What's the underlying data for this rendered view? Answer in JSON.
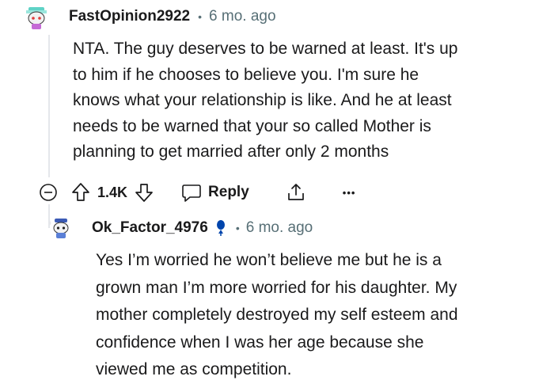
{
  "comment": {
    "username": "FastOpinion2922",
    "time_ago": "6 mo. ago",
    "separator": "•",
    "body_lines": [
      "NTA. The guy deserves to be warned at least. It's up",
      "to him if he chooses to believe you. I'm sure he",
      "knows what your relationship is like. And he at least",
      "needs to be warned that your so called Mother is",
      "planning to get married after only 2 months"
    ],
    "vote_count": "1.4K",
    "reply_label": "Reply",
    "more_label": "•••"
  },
  "reply": {
    "username": "Ok_Factor_4976",
    "time_ago": "6 mo. ago",
    "separator": "•",
    "body_lines": [
      "Yes I’m worried he won’t believe me but he is a",
      "grown man I’m more worried for his daughter. My",
      "mother completely destroyed my self esteem and",
      "confidence when I was her age because she",
      "viewed me as competition."
    ]
  },
  "icons": {
    "collapse": "collapse-icon",
    "upvote": "upvote-arrow-icon",
    "downvote": "downvote-arrow-icon",
    "reply": "speech-bubble-icon",
    "share": "share-icon",
    "more": "more-options-icon",
    "op_badge": "microphone-icon"
  },
  "colors": {
    "text": "#1a1a1b",
    "meta": "#576f76",
    "thread": "#e5e7eb",
    "avatar_accent": "#5fd3c6"
  }
}
